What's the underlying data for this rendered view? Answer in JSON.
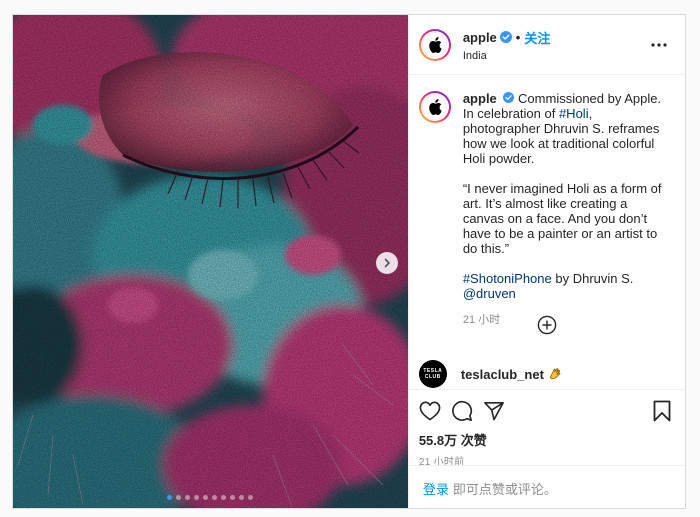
{
  "post": {
    "author": {
      "username": "apple",
      "follow_label": "关注",
      "separator": "•",
      "location": "India"
    },
    "caption": {
      "username": "apple",
      "segments": {
        "intro_a": "Commissioned by Apple. In celebration of ",
        "hashtag_holi": "#Holi",
        "intro_b": ", photographer Dhruvin S. reframes how we look at traditional colorful Holi powder.",
        "quote": "“I never imagined Holi as a form of art. It’s almost like creating a canvas on a face. And you don’t have to be a painter or an artist to do this.”",
        "hashtag_shot": "#ShotoniPhone",
        "credit": " by Dhruvin S.",
        "mention": "@druven"
      },
      "time": "21 小时"
    },
    "comment": {
      "username": "teslaclub_net",
      "avatar_text_top": "TESLA",
      "avatar_text_bottom": "CLUB"
    },
    "likes": "55.8万 次赞",
    "posted": "21 小时前",
    "login": {
      "link": "登录",
      "text": "即可点赞或评论。"
    },
    "carousel": {
      "total": 10,
      "active_index": 0
    }
  },
  "colors": {
    "accent": "#0095f6",
    "link": "#00376b",
    "muted": "#8e8e8e",
    "verified": "#3897f0",
    "pink": "#d2337a",
    "teal": "#3aa7b3"
  },
  "icons": {
    "verified": "verified-badge-icon",
    "more": "more-options-icon",
    "next": "chevron-right-icon",
    "load_more": "plus-circle-icon",
    "like": "heart-icon",
    "comment": "comment-icon",
    "share": "share-icon",
    "save": "bookmark-icon",
    "emoji": "clapping-hands-icon"
  }
}
